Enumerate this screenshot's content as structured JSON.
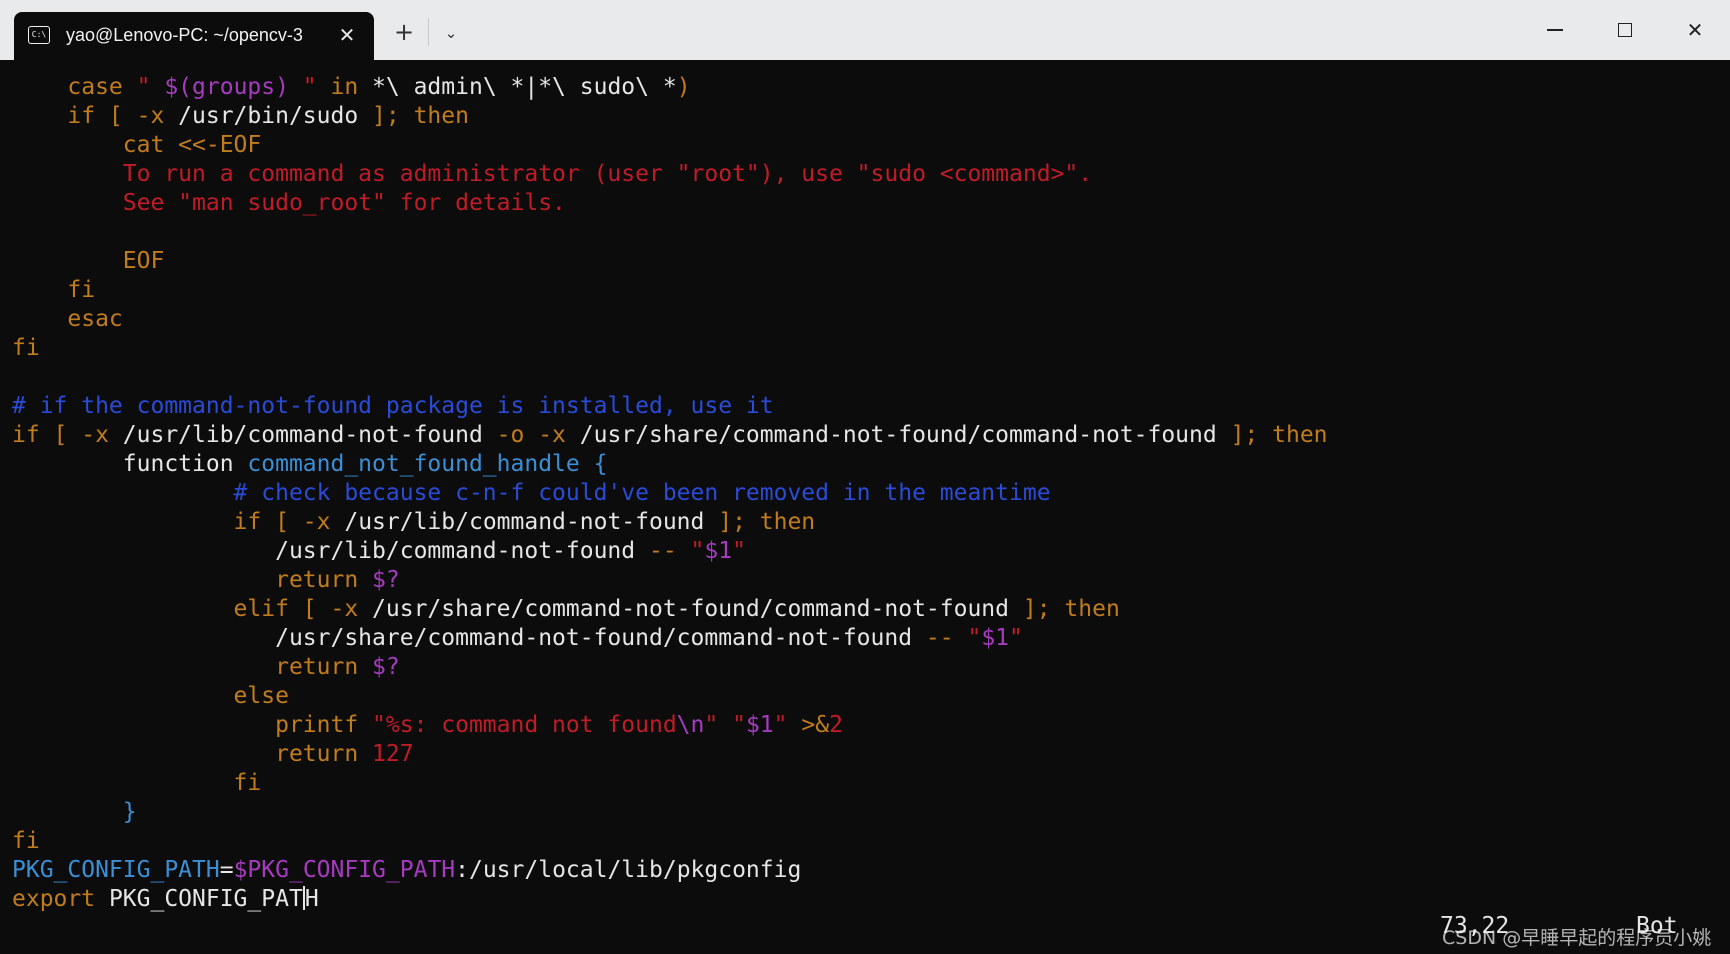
{
  "window": {
    "tab_title": "yao@Lenovo-PC: ~/opencv-3",
    "tab_icon_glyph": "C:\\",
    "tab_close_glyph": "✕",
    "new_tab_glyph": "+",
    "dropdown_glyph": "⌄",
    "close_glyph": "✕"
  },
  "icons": {
    "tab": "terminal-icon",
    "close": "close-icon",
    "new_tab": "plus-icon",
    "dropdown": "chevron-down-icon",
    "minimize": "minimize-icon",
    "maximize": "maximize-icon",
    "window_close": "close-icon"
  },
  "colors": {
    "background": "#0c0c0c",
    "titlebar": "#e9eaeb",
    "keyword": "#c17c1c",
    "string": "#c01c28",
    "variable": "#a63bc0",
    "comment": "#2a4bd8",
    "function": "#3b8fd6",
    "text": "#e6e6e6"
  },
  "lines": [
    [
      [
        "k",
        "    case "
      ],
      [
        "s",
        "\" "
      ],
      [
        "v",
        "$(groups)"
      ],
      [
        "s",
        " \""
      ],
      [
        "k",
        " in "
      ],
      [
        "t",
        "*\\ admin\\ *|*\\ sudo\\ *"
      ],
      [
        "k",
        ")"
      ]
    ],
    [
      [
        "k",
        "    if [ -x "
      ],
      [
        "t",
        "/usr/bin/sudo"
      ],
      [
        "k",
        " ]; then"
      ]
    ],
    [
      [
        "k",
        "        cat <<-EOF"
      ]
    ],
    [
      [
        "s",
        "        To run a command as administrator (user \"root\"), use \"sudo <command>\"."
      ]
    ],
    [
      [
        "s",
        "        See \"man sudo_root\" for details."
      ]
    ],
    [
      [
        "t",
        ""
      ]
    ],
    [
      [
        "k",
        "        EOF"
      ]
    ],
    [
      [
        "k",
        "    fi"
      ]
    ],
    [
      [
        "k",
        "    esac"
      ]
    ],
    [
      [
        "k",
        "fi"
      ]
    ],
    [
      [
        "t",
        ""
      ]
    ],
    [
      [
        "c",
        "# if the command-not-found package is installed, use it"
      ]
    ],
    [
      [
        "k",
        "if [ -x "
      ],
      [
        "t",
        "/usr/lib/command-not-found"
      ],
      [
        "k",
        " -o -x "
      ],
      [
        "t",
        "/usr/share/command-not-found/command-not-found"
      ],
      [
        "k",
        " ]; then"
      ]
    ],
    [
      [
        "t",
        "        function "
      ],
      [
        "f",
        "command_not_found_handle {"
      ]
    ],
    [
      [
        "c",
        "                # check because c-n-f could've been removed in the meantime"
      ]
    ],
    [
      [
        "k",
        "                if [ -x "
      ],
      [
        "t",
        "/usr/lib/command-not-found"
      ],
      [
        "k",
        " ]; then"
      ]
    ],
    [
      [
        "t",
        "                   /usr/lib/command-not-found"
      ],
      [
        "k",
        " -- "
      ],
      [
        "s",
        "\""
      ],
      [
        "v",
        "$1"
      ],
      [
        "s",
        "\""
      ]
    ],
    [
      [
        "k",
        "                   return "
      ],
      [
        "v",
        "$?"
      ]
    ],
    [
      [
        "k",
        "                elif [ -x "
      ],
      [
        "t",
        "/usr/share/command-not-found/command-not-found"
      ],
      [
        "k",
        " ]; then"
      ]
    ],
    [
      [
        "t",
        "                   /usr/share/command-not-found/command-not-found"
      ],
      [
        "k",
        " -- "
      ],
      [
        "s",
        "\""
      ],
      [
        "v",
        "$1"
      ],
      [
        "s",
        "\""
      ]
    ],
    [
      [
        "k",
        "                   return "
      ],
      [
        "v",
        "$?"
      ]
    ],
    [
      [
        "k",
        "                else"
      ]
    ],
    [
      [
        "k",
        "                   printf "
      ],
      [
        "s",
        "\"%s: command not found"
      ],
      [
        "v",
        "\\n"
      ],
      [
        "s",
        "\""
      ],
      [
        "t",
        " "
      ],
      [
        "s",
        "\""
      ],
      [
        "v",
        "$1"
      ],
      [
        "s",
        "\""
      ],
      [
        "t",
        " "
      ],
      [
        "k",
        ">&"
      ],
      [
        "s",
        "2"
      ]
    ],
    [
      [
        "k",
        "                   return "
      ],
      [
        "s",
        "127"
      ]
    ],
    [
      [
        "k",
        "                fi"
      ]
    ],
    [
      [
        "f",
        "        }"
      ]
    ],
    [
      [
        "k",
        "fi"
      ]
    ],
    [
      [
        "f",
        "PKG_CONFIG_PATH"
      ],
      [
        "t",
        "="
      ],
      [
        "v",
        "$PKG_CONFIG_PATH"
      ],
      [
        "t",
        ":/usr/local/lib/pkgconfig"
      ]
    ],
    [
      [
        "k",
        "export "
      ],
      [
        "t",
        "PKG_CONFIG_PAT"
      ],
      [
        "cursor",
        ""
      ],
      [
        "t",
        "H"
      ]
    ]
  ],
  "status": {
    "position": "73,22",
    "scroll": "Bot"
  },
  "watermark": "CSDN @早睡早起的程序员小姚"
}
